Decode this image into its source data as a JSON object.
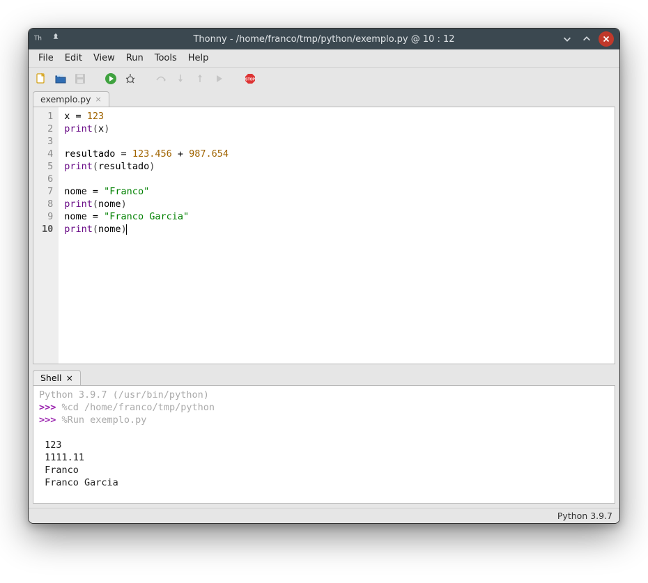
{
  "titlebar": {
    "title": "Thonny  - /home/franco/tmp/python/exemplo.py  @  10 : 12"
  },
  "menu": [
    "File",
    "Edit",
    "View",
    "Run",
    "Tools",
    "Help"
  ],
  "editor": {
    "tab_label": "exemplo.py",
    "cursor_line": 10,
    "lines": [
      {
        "n": 1,
        "t": [
          [
            "name",
            "x "
          ],
          [
            "op",
            "= "
          ],
          [
            "num",
            "123"
          ]
        ]
      },
      {
        "n": 2,
        "t": [
          [
            "fn",
            "print"
          ],
          [
            "paren",
            "("
          ],
          [
            "name",
            "x"
          ],
          [
            "paren",
            ")"
          ]
        ]
      },
      {
        "n": 3,
        "t": []
      },
      {
        "n": 4,
        "t": [
          [
            "name",
            "resultado "
          ],
          [
            "op",
            "= "
          ],
          [
            "num",
            "123.456"
          ],
          [
            "op",
            " + "
          ],
          [
            "num",
            "987.654"
          ]
        ]
      },
      {
        "n": 5,
        "t": [
          [
            "fn",
            "print"
          ],
          [
            "paren",
            "("
          ],
          [
            "name",
            "resultado"
          ],
          [
            "paren",
            ")"
          ]
        ]
      },
      {
        "n": 6,
        "t": []
      },
      {
        "n": 7,
        "t": [
          [
            "name",
            "nome "
          ],
          [
            "op",
            "= "
          ],
          [
            "str",
            "\"Franco\""
          ]
        ]
      },
      {
        "n": 8,
        "t": [
          [
            "fn",
            "print"
          ],
          [
            "paren",
            "("
          ],
          [
            "name",
            "nome"
          ],
          [
            "paren",
            ")"
          ]
        ]
      },
      {
        "n": 9,
        "t": [
          [
            "name",
            "nome "
          ],
          [
            "op",
            "= "
          ],
          [
            "str",
            "\"Franco Garcia\""
          ]
        ]
      },
      {
        "n": 10,
        "t": [
          [
            "fn",
            "print"
          ],
          [
            "paren",
            "("
          ],
          [
            "name",
            "nome"
          ],
          [
            "paren",
            ")"
          ]
        ]
      }
    ]
  },
  "shell": {
    "tab_label": "Shell",
    "banner": "Python 3.9.7 (/usr/bin/python)",
    "prompt": ">>>",
    "entries": [
      {
        "type": "magic",
        "text": "%cd /home/franco/tmp/python"
      },
      {
        "type": "magic",
        "text": "%Run exemplo.py"
      }
    ],
    "output": [
      "123",
      "1111.11",
      "Franco",
      "Franco Garcia"
    ]
  },
  "status": {
    "interpreter": "Python 3.9.7"
  }
}
